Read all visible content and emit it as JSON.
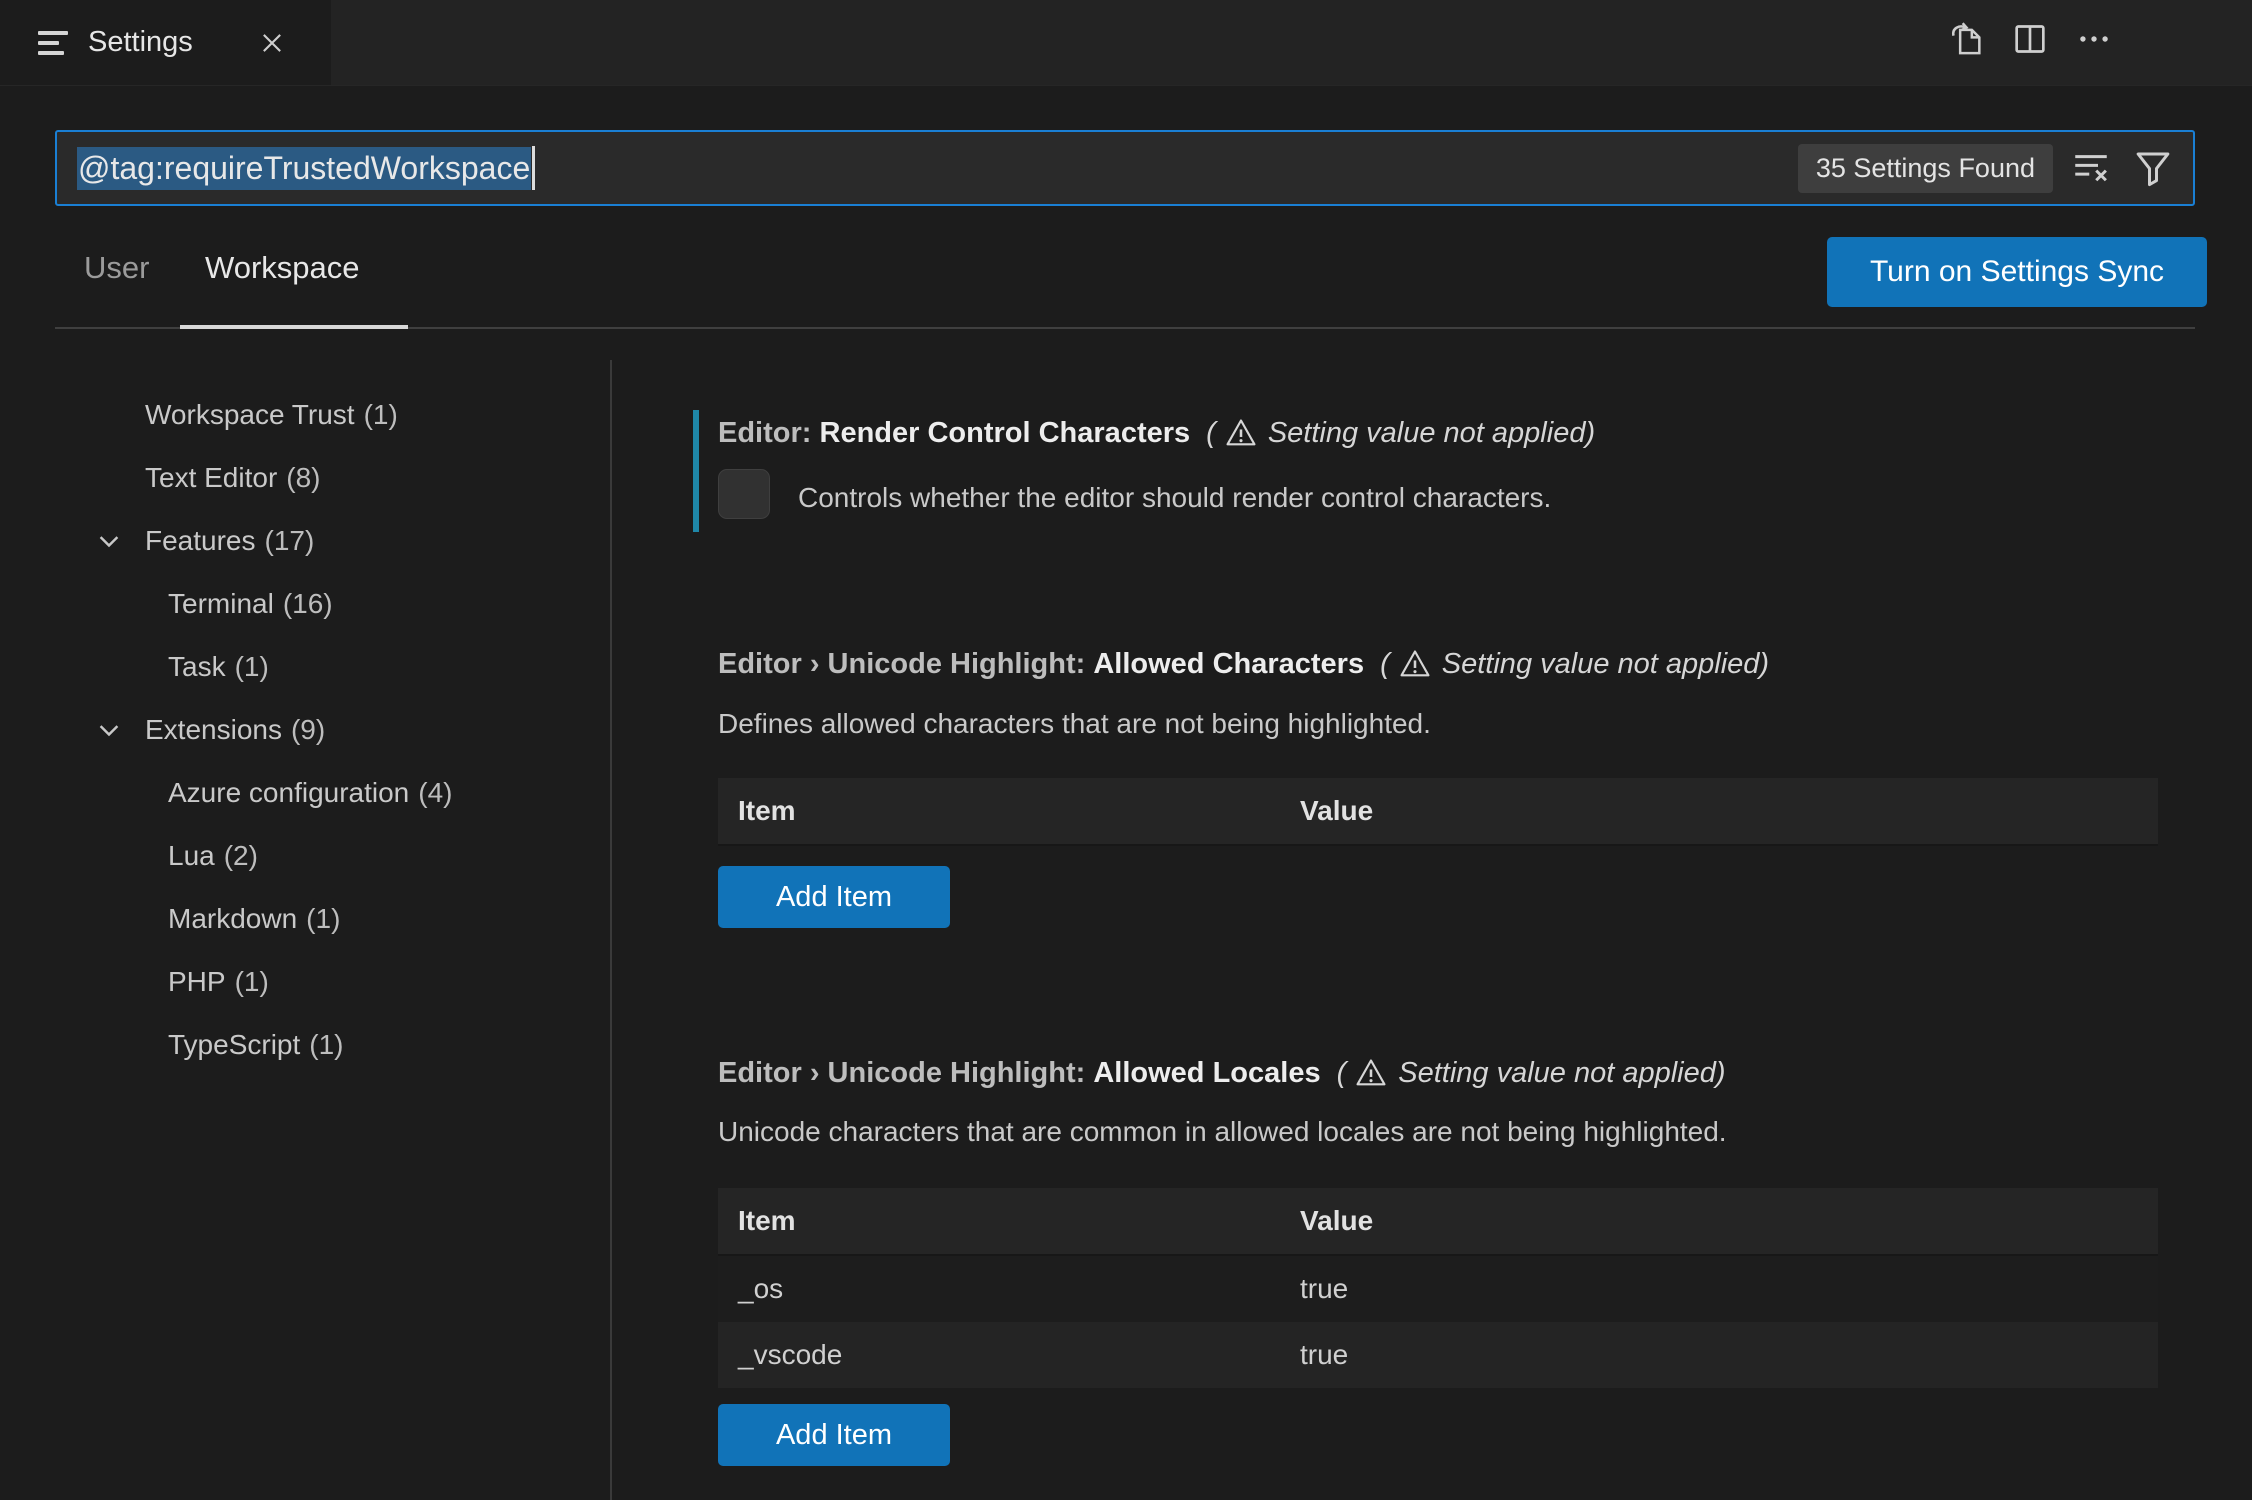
{
  "window": {
    "tab_title": "Settings"
  },
  "search": {
    "query": "@tag:requireTrustedWorkspace",
    "results_badge": "35 Settings Found"
  },
  "scope_tabs": {
    "user": "User",
    "workspace": "Workspace",
    "active": "Workspace"
  },
  "sync_button": {
    "label": "Turn on Settings Sync"
  },
  "sidebar": {
    "items": [
      {
        "label": "Workspace Trust",
        "count": "(1)",
        "level": 1,
        "expandable": false
      },
      {
        "label": "Text Editor",
        "count": "(8)",
        "level": 1,
        "expandable": false
      },
      {
        "label": "Features",
        "count": "(17)",
        "level": 1,
        "expandable": true
      },
      {
        "label": "Terminal",
        "count": "(16)",
        "level": 2,
        "expandable": false
      },
      {
        "label": "Task",
        "count": "(1)",
        "level": 2,
        "expandable": false
      },
      {
        "label": "Extensions",
        "count": "(9)",
        "level": 1,
        "expandable": true
      },
      {
        "label": "Azure configuration",
        "count": "(4)",
        "level": 2,
        "expandable": false
      },
      {
        "label": "Lua",
        "count": "(2)",
        "level": 2,
        "expandable": false
      },
      {
        "label": "Markdown",
        "count": "(1)",
        "level": 2,
        "expandable": false
      },
      {
        "label": "PHP",
        "count": "(1)",
        "level": 2,
        "expandable": false
      },
      {
        "label": "TypeScript",
        "count": "(1)",
        "level": 2,
        "expandable": false
      }
    ]
  },
  "settings": [
    {
      "category": "Editor: ",
      "name": "Render Control Characters",
      "warning_prefix": "(",
      "warning_text": "Setting value not applied)",
      "description": "Controls whether the editor should render control characters.",
      "control": "checkbox",
      "checked": false,
      "modified": true
    },
    {
      "category": "Editor › Unicode Highlight: ",
      "name": "Allowed Characters",
      "warning_prefix": "(",
      "warning_text": "Setting value not applied)",
      "description": "Defines allowed characters that are not being highlighted.",
      "table": {
        "headers": [
          "Item",
          "Value"
        ],
        "rows": []
      },
      "add_button": "Add Item"
    },
    {
      "category": "Editor › Unicode Highlight: ",
      "name": "Allowed Locales",
      "warning_prefix": "(",
      "warning_text": "Setting value not applied)",
      "description": "Unicode characters that are common in allowed locales are not being highlighted.",
      "table": {
        "headers": [
          "Item",
          "Value"
        ],
        "rows": [
          {
            "item": "_os",
            "value": "true"
          },
          {
            "item": "_vscode",
            "value": "true"
          }
        ]
      },
      "add_button": "Add Item"
    }
  ],
  "colors": {
    "background": "#1c1c1c",
    "focus_border": "#1a7fd4",
    "button": "#1173b8",
    "text_selection": "#2b5a83",
    "modified_indicator": "#1f87a8",
    "badge_bg": "#3e3e3e"
  }
}
